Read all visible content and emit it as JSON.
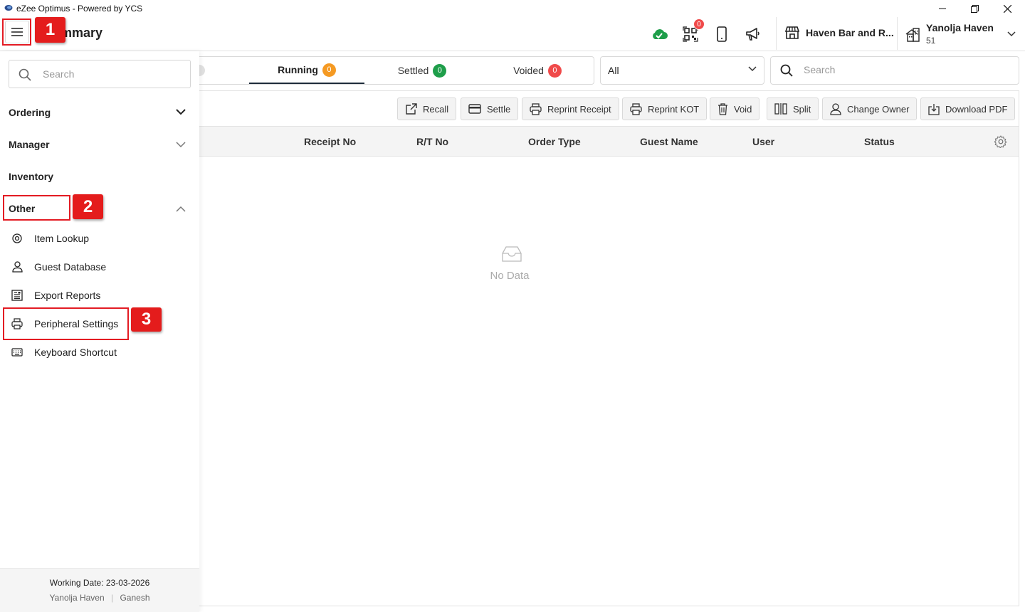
{
  "window": {
    "title": "eZee Optimus - Powered by YCS"
  },
  "header": {
    "page_title": "r Summary",
    "notification_count": "0",
    "outlet_name": "Haven Bar and R...",
    "property_name": "Yanolja Haven",
    "property_number": "51"
  },
  "tabs": [
    {
      "label": "Running",
      "count": "0",
      "color": "#f59a23"
    },
    {
      "label": "Settled",
      "count": "0",
      "color": "#1e9e4a"
    },
    {
      "label": "Voided",
      "count": "0",
      "color": "#f04a4a"
    }
  ],
  "filter": {
    "selected": "All"
  },
  "search": {
    "placeholder": "Search"
  },
  "toolbar": {
    "recall": "Recall",
    "settle": "Settle",
    "reprint_receipt": "Reprint Receipt",
    "reprint_kot": "Reprint KOT",
    "void": "Void",
    "split": "Split",
    "change_owner": "Change Owner",
    "download_pdf": "Download PDF"
  },
  "table": {
    "columns": [
      "Receipt No",
      "R/T No",
      "Order Type",
      "Guest Name",
      "User",
      "Status"
    ],
    "empty_text": "No Data"
  },
  "sidebar": {
    "search_placeholder": "Search",
    "groups": [
      "Ordering",
      "Manager",
      "Inventory",
      "Other"
    ],
    "other_items": [
      "Item Lookup",
      "Guest Database",
      "Export Reports",
      "Peripheral Settings",
      "Keyboard Shortcut"
    ],
    "footer": {
      "working_date": "Working Date: 23-03-2026",
      "property": "Yanolja Haven",
      "separator": "|",
      "user": "Ganesh"
    }
  },
  "annotations": [
    "1",
    "2",
    "3"
  ],
  "colors": {
    "accent_red": "#e31b23",
    "nav_dark": "#1d2b3a",
    "cloud_green": "#1e9e4a"
  }
}
